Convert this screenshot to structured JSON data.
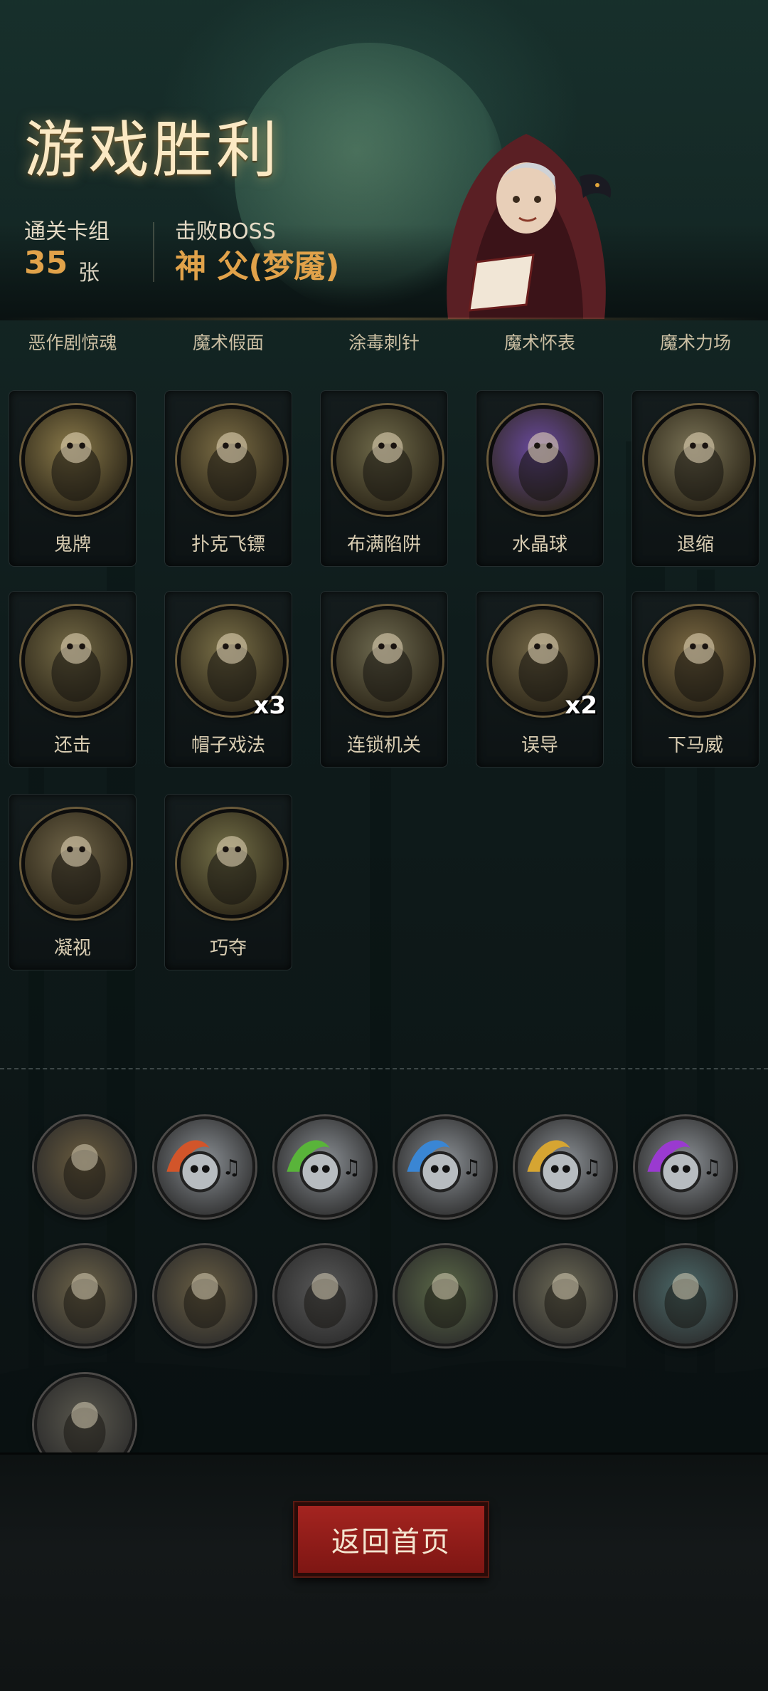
{
  "result": {
    "title": "游戏胜利",
    "deck_label": "通关卡组",
    "deck_count": "35",
    "deck_unit": "张",
    "boss_label": "击败BOSS",
    "boss_name": "神 父(梦魇)"
  },
  "top_row_labels": [
    "恶作剧惊魂",
    "魔术假面",
    "涂毒刺针",
    "魔术怀表",
    "魔术力场"
  ],
  "cards": [
    {
      "name": "鬼牌",
      "count": "",
      "icon": "joker-skull-icon",
      "color": "#8a7a4a"
    },
    {
      "name": "扑克飞镖",
      "count": "",
      "icon": "card-dart-icon",
      "color": "#7b6d45"
    },
    {
      "name": "布满陷阱",
      "count": "",
      "icon": "spike-trap-icon",
      "color": "#6f6a4a"
    },
    {
      "name": "水晶球",
      "count": "",
      "icon": "crystal-ball-icon",
      "color": "#6a4aa0"
    },
    {
      "name": "退缩",
      "count": "",
      "icon": "retreat-icon",
      "color": "#7a7356"
    },
    {
      "name": "还击",
      "count": "",
      "icon": "counter-attack-icon",
      "color": "#746a46"
    },
    {
      "name": "帽子戏法",
      "count": "x3",
      "icon": "hat-rabbit-icon",
      "color": "#7a7048"
    },
    {
      "name": "连锁机关",
      "count": "",
      "icon": "chain-mechanism-icon",
      "color": "#6e6a50"
    },
    {
      "name": "误导",
      "count": "x2",
      "icon": "misdirect-skull-icon",
      "color": "#726646"
    },
    {
      "name": "下马威",
      "count": "",
      "icon": "intimidate-icon",
      "color": "#7a6842"
    },
    {
      "name": "凝视",
      "count": "",
      "icon": "owl-gaze-icon",
      "color": "#6f6448"
    },
    {
      "name": "巧夺",
      "count": "",
      "icon": "steal-icon",
      "color": "#747048"
    }
  ],
  "relics": [
    {
      "icon": "skull-card-relic-icon",
      "color": "#6a5c3e"
    },
    {
      "icon": "music-skull-red-relic-icon",
      "color": "#d2552a"
    },
    {
      "icon": "music-skull-green-relic-icon",
      "color": "#59b43a"
    },
    {
      "icon": "music-skull-blue-relic-icon",
      "color": "#3a86d4"
    },
    {
      "icon": "music-skull-gold-relic-icon",
      "color": "#d6a532"
    },
    {
      "icon": "music-skull-purple-relic-icon",
      "color": "#9a3ad0"
    },
    {
      "icon": "performers-relic-icon",
      "color": "#6e6449"
    },
    {
      "icon": "claw-hand-relic-icon",
      "color": "#6a5f44"
    },
    {
      "icon": "mystery-box-relic-icon",
      "color": "#5a5a5a"
    },
    {
      "icon": "ghoul-relic-icon",
      "color": "#5c6a48"
    },
    {
      "icon": "magician-relic-icon",
      "color": "#6d6a56"
    },
    {
      "icon": "hooded-figure-relic-icon",
      "color": "#4c6a6a"
    },
    {
      "icon": "blade-relic-icon",
      "color": "#5a584e"
    }
  ],
  "footer": {
    "return_label": "返回首页"
  }
}
